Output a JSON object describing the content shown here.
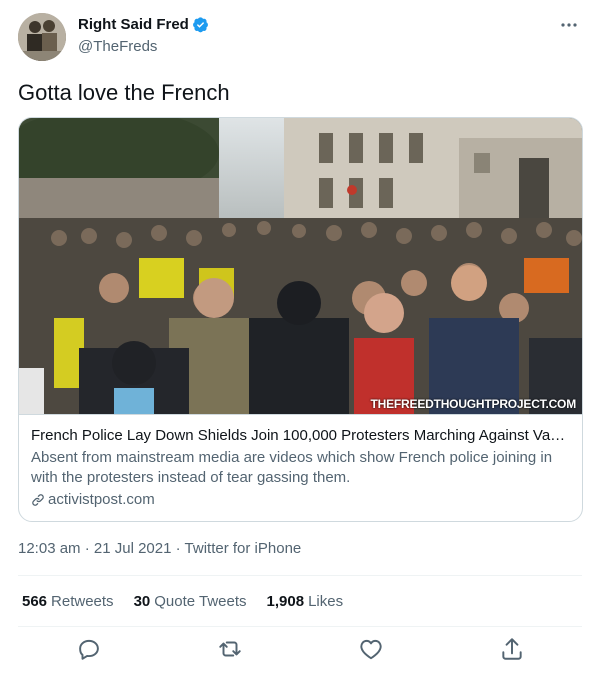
{
  "author": {
    "display_name": "Right Said Fred",
    "handle": "@TheFreds",
    "verified": true
  },
  "tweet": {
    "text": "Gotta love the French"
  },
  "card": {
    "watermark": "THEFREEDTHOUGHTPROJECT.COM",
    "title": "French Police Lay Down Shields Join 100,000 Protesters Marching Against Vaccin...",
    "description": "Absent from mainstream media are videos which show French police joining in with the protesters instead of tear gassing them.",
    "domain": "activistpost.com"
  },
  "meta": {
    "time": "12:03 am",
    "separator": "·",
    "date": "21 Jul 2021",
    "source": "Twitter for iPhone"
  },
  "stats": {
    "retweets_count": "566",
    "retweets_label": "Retweets",
    "quotes_count": "30",
    "quotes_label": "Quote Tweets",
    "likes_count": "1,908",
    "likes_label": "Likes"
  },
  "icons": [
    "more-icon",
    "verified-icon",
    "link-icon",
    "reply-icon",
    "retweet-icon",
    "like-icon",
    "share-icon"
  ],
  "colors": {
    "verified": "#1d9bf0",
    "secondary_text": "#536471",
    "primary_text": "#0f1419",
    "border": "#cfd9de"
  }
}
